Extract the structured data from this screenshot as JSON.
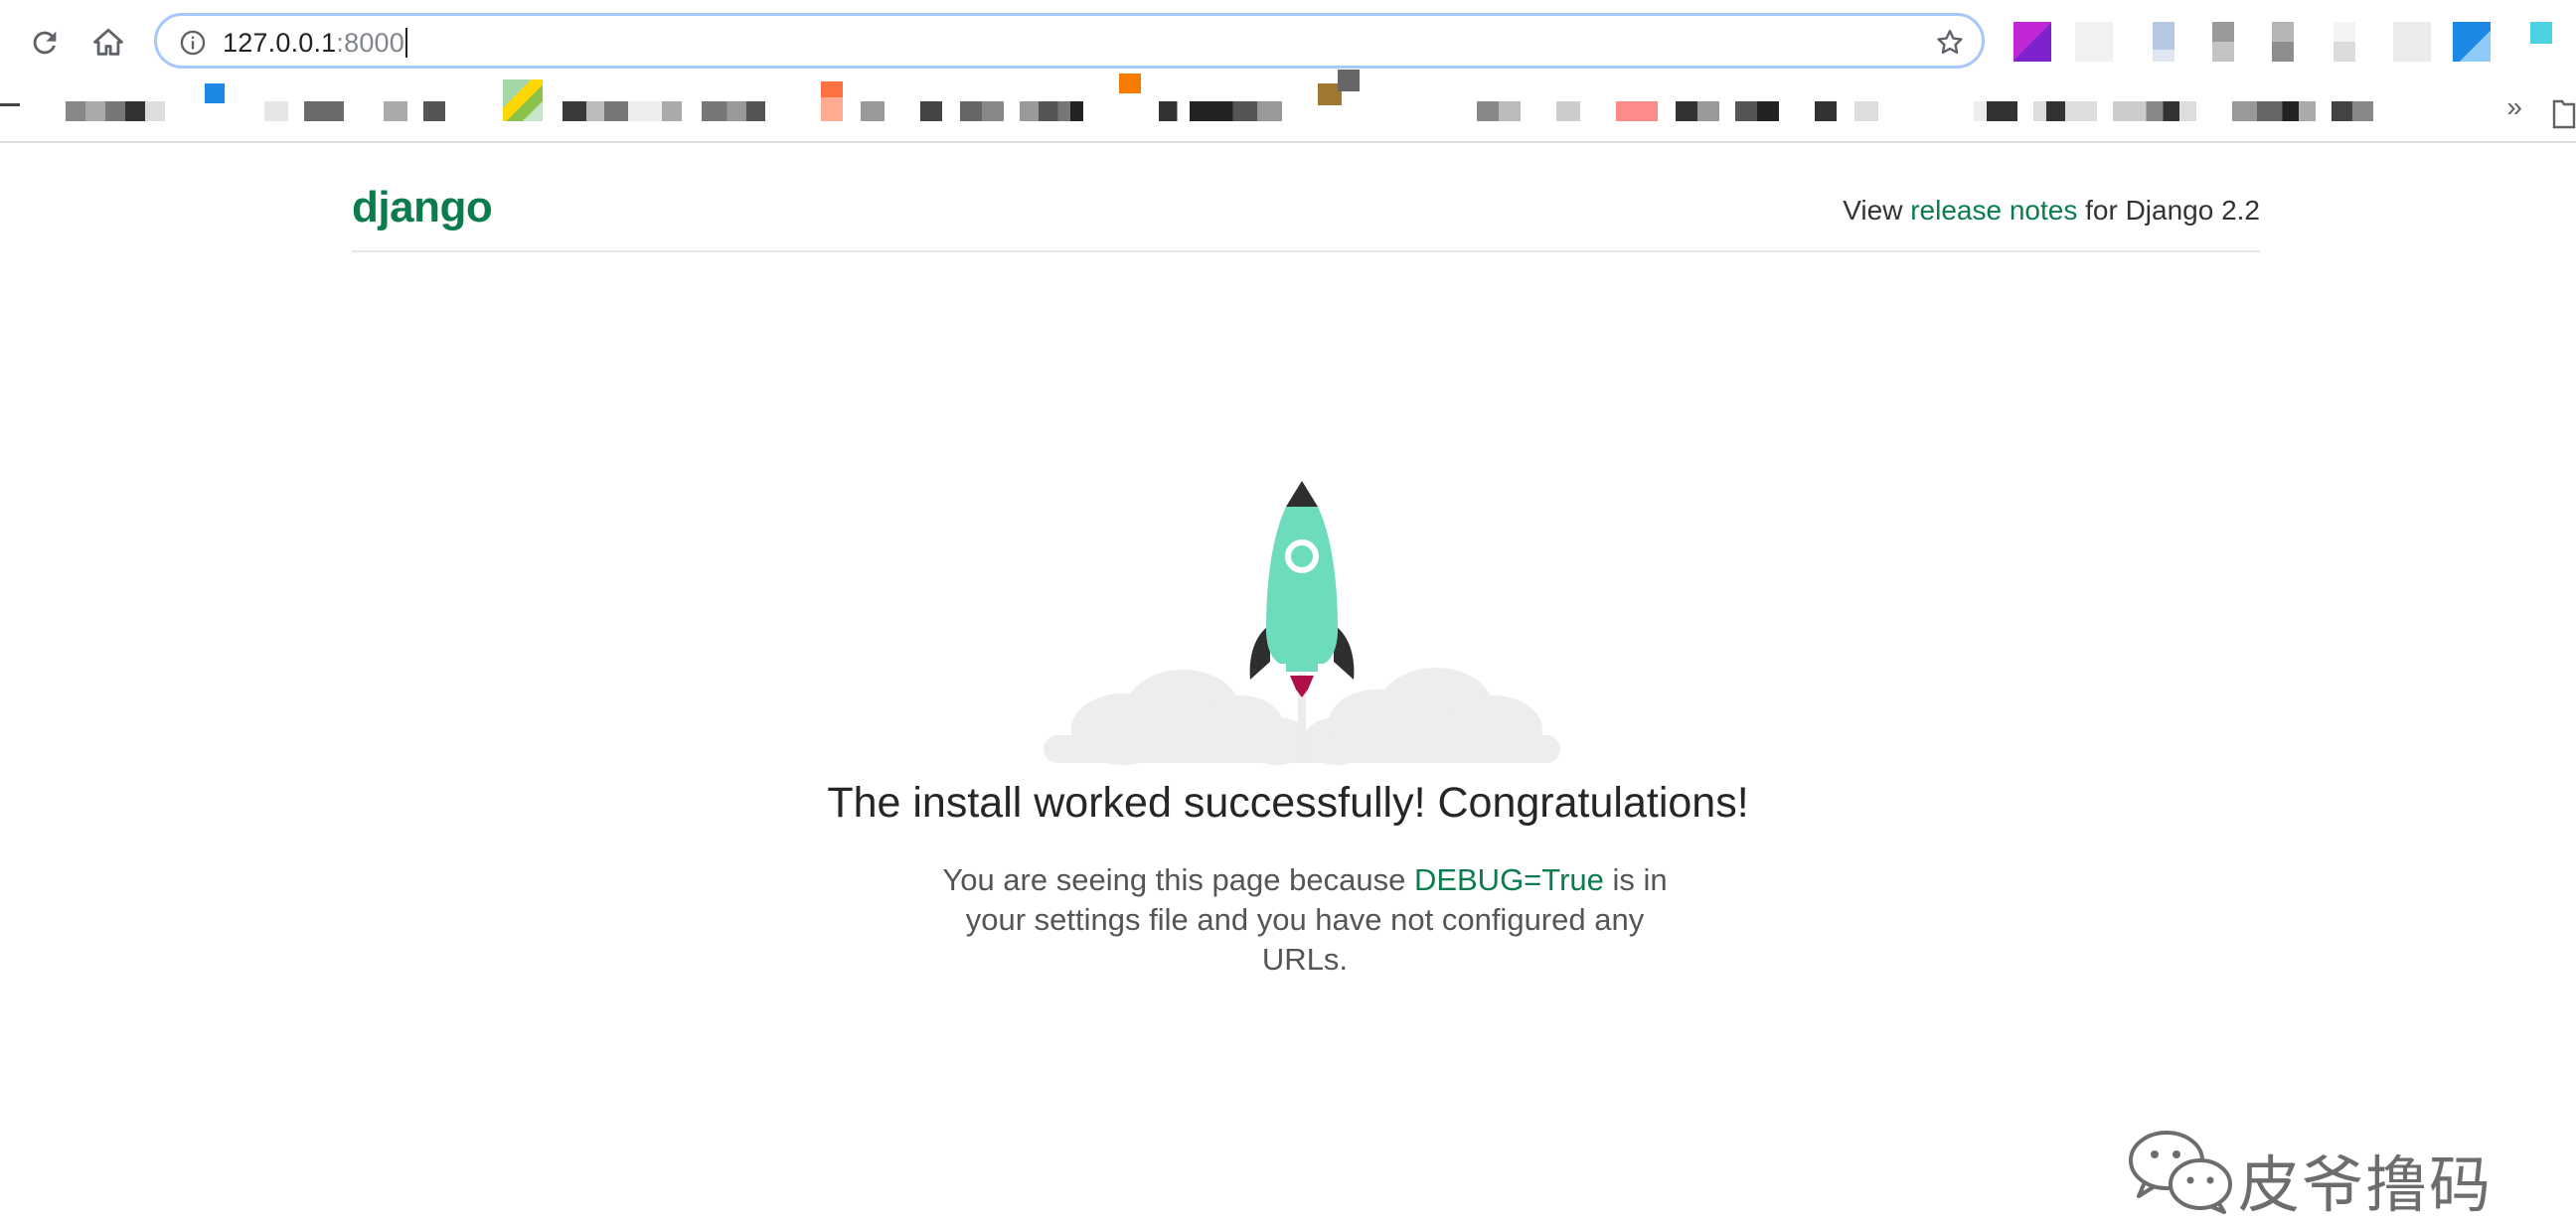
{
  "browser": {
    "url_host": "127.0.0.1",
    "url_port": ":8000",
    "bookmarks_overflow": "»"
  },
  "page": {
    "logo": "django",
    "release_prefix": "View ",
    "release_link": "release notes",
    "release_suffix": " for Django 2.2",
    "headline": "The install worked successfully! Congratulations!",
    "sub_prefix": "You are seeing this page because ",
    "sub_link": "DEBUG=True",
    "sub_suffix": " is in your settings file and you have not configured any URLs."
  },
  "watermark": {
    "text": "皮爷撸码"
  },
  "colors": {
    "django_green": "#0c7c4e",
    "rocket_body": "#6ddcbd",
    "rocket_dark": "#2e2e2e",
    "flame": "#b0104a",
    "cloud": "#ededf0"
  }
}
